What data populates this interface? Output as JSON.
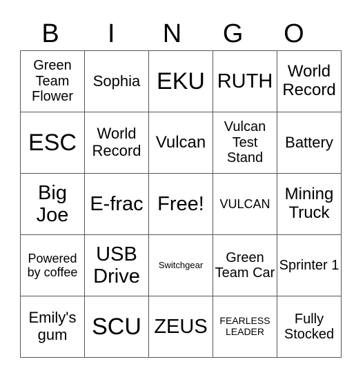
{
  "header": [
    "B",
    "I",
    "N",
    "G",
    "O"
  ],
  "rows": [
    [
      {
        "text": "Green Team Flower",
        "size": "s-sm"
      },
      {
        "text": "Sophia",
        "size": "s-m"
      },
      {
        "text": "EKU",
        "size": "s-xl"
      },
      {
        "text": "RUTH",
        "size": "s-l"
      },
      {
        "text": "World Record",
        "size": "s-ml"
      }
    ],
    [
      {
        "text": "ESC",
        "size": "s-xl"
      },
      {
        "text": "World Record",
        "size": "s-m"
      },
      {
        "text": "Vulcan",
        "size": "s-ml"
      },
      {
        "text": "Vulcan Test Stand",
        "size": "s-sm"
      },
      {
        "text": "Battery",
        "size": "s-m"
      }
    ],
    [
      {
        "text": "Big Joe",
        "size": "s-l"
      },
      {
        "text": "E-frac",
        "size": "s-l"
      },
      {
        "text": "Free!",
        "size": "s-l"
      },
      {
        "text": "VULCAN",
        "size": "s-s"
      },
      {
        "text": "Mining Truck",
        "size": "s-ml"
      }
    ],
    [
      {
        "text": "Powered by coffee",
        "size": "s-s"
      },
      {
        "text": "USB Drive",
        "size": "s-l"
      },
      {
        "text": "Switchgear",
        "size": "s-xxs"
      },
      {
        "text": "Green Team Car",
        "size": "s-sm"
      },
      {
        "text": "Sprinter 1",
        "size": "s-sm"
      }
    ],
    [
      {
        "text": "Emily's gum",
        "size": "s-m"
      },
      {
        "text": "SCU",
        "size": "s-xl"
      },
      {
        "text": "ZEUS",
        "size": "s-l"
      },
      {
        "text": "FEARLESS LEADER",
        "size": "s-xs"
      },
      {
        "text": "Fully Stocked",
        "size": "s-sm"
      }
    ]
  ]
}
